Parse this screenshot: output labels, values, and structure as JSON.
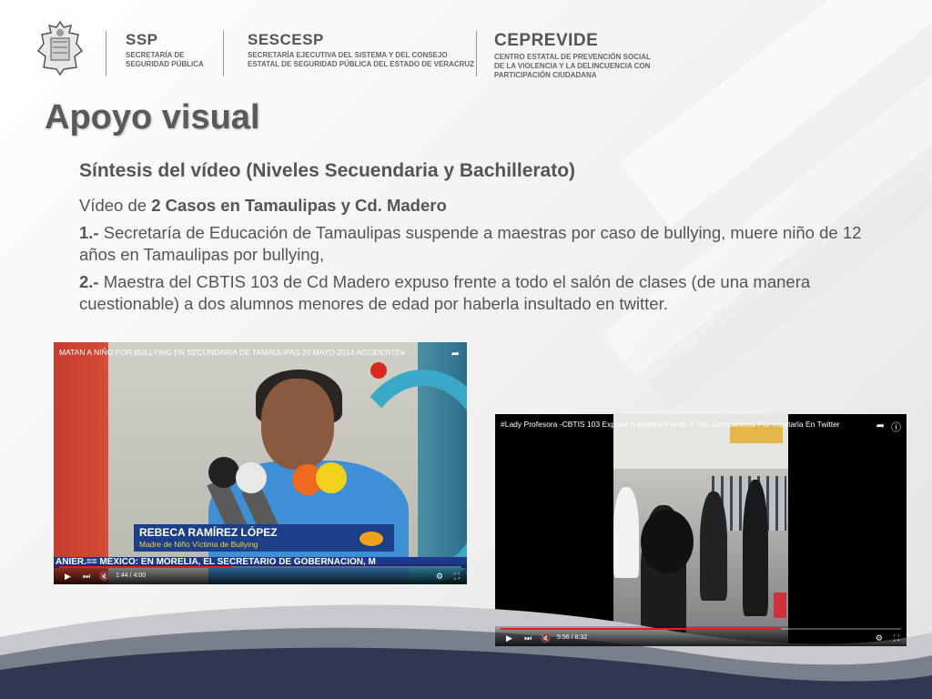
{
  "header": {
    "ssp": {
      "title": "SSP",
      "sub": [
        "SECRETARÍA DE",
        "SEGURIDAD PÚBLICA"
      ]
    },
    "sescesp": {
      "title": "SESCESP",
      "sub": [
        "SECRETARÍA EJECUTIVA DEL SISTEMA Y DEL CONSEJO",
        "ESTATAL DE SEGURIDAD PÚBLICA DEL ESTADO DE VERACRUZ"
      ]
    },
    "ceprevide": {
      "title": "CEPREVIDE",
      "sub": [
        "CENTRO ESTATAL DE PREVENCIÓN SOCIAL",
        "DE LA VIOLENCIA Y LA DELINCUENCIA CON",
        "PARTICIPACIÓN CIUDADANA"
      ]
    }
  },
  "title": "Apoyo visual",
  "subtitle": "Síntesis del vídeo (Niveles Secuendaria y Bachillerato)",
  "body": {
    "intro_prefix": "Vídeo de ",
    "intro_bold": "2 Casos en Tamaulipas y Cd. Madero",
    "item1_num": "1.-",
    "item1_text": " Secretaría de Educación de Tamaulipas suspende a maestras por caso de bullying, muere niño de 12 años en Tamaulipas por bullying,",
    "item2_num": "2.-",
    "item2_text": " Maestra del CBTIS 103 de Cd Madero expuso frente a todo el salón de clases (de una manera cuestionable) a dos alumnos menores de edad por haberla insultado en twitter."
  },
  "video1": {
    "title": "MATAN A NIÑO POR BULLYING EN SECUNDARIA DE TAMAULIPAS 20 MAYO 2014 ACCIDENTEe",
    "lower_third_name": "REBECA RAMÍREZ LÓPEZ",
    "lower_third_role": "Madre de Niño Víctima de Bullying",
    "ticker": "ANIER.== MÉXICO: EN MORELIA, EL SECRETARIO DE GOBERNACIÓN, M",
    "time": "1:44 / 4:00",
    "progress": 0.43
  },
  "video2": {
    "title": "#Lady Profesora -CBTIS 103 Expone A Alumna Frente A Sus Compañeros Por Insultarla En Twitter",
    "time": "5:56 / 8:32",
    "progress": 0.7
  },
  "controls": {
    "play": "▶",
    "next": "⏭",
    "volume": "🔇",
    "settings": "⚙",
    "fullscreen": "⛶",
    "share": "➦"
  },
  "colors": {
    "title": "#5a5a5a",
    "text": "#555555",
    "wave_dark": "#2f3850",
    "wave_mid": "#7a7f8c",
    "progress": "#e62117"
  }
}
